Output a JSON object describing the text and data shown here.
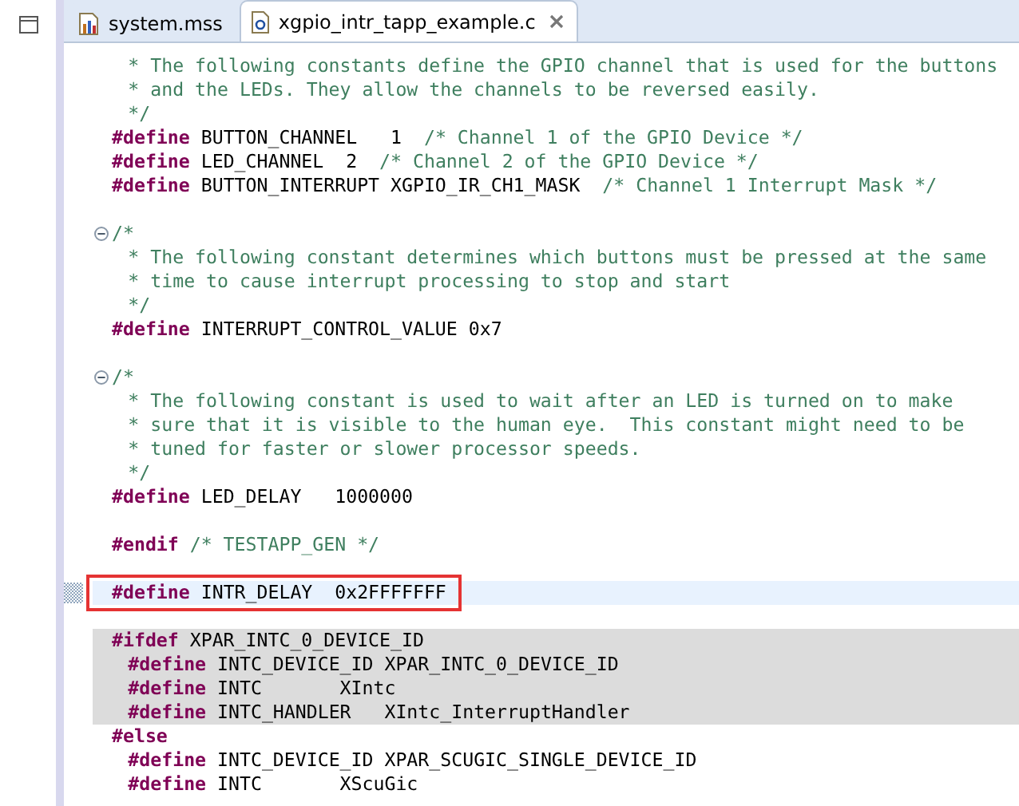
{
  "tabs": [
    {
      "label": "system.mss",
      "kind": "config",
      "selected": false,
      "closable": false
    },
    {
      "label": "xgpio_intr_tapp_example.c",
      "kind": "c",
      "selected": true,
      "closable": true
    }
  ],
  "lines": [
    {
      "kind": "code",
      "indented": true,
      "foldable": false,
      "inactive": false,
      "current": false,
      "boxed": false,
      "comment": "* The following constants define the GPIO channel that is used for the buttons"
    },
    {
      "kind": "code",
      "indented": true,
      "foldable": false,
      "inactive": false,
      "current": false,
      "boxed": false,
      "comment": "* and the LEDs. They allow the channels to be reversed easily."
    },
    {
      "kind": "code",
      "indented": true,
      "foldable": false,
      "inactive": false,
      "current": false,
      "boxed": false,
      "comment": "*/"
    },
    {
      "kind": "code",
      "indented": false,
      "foldable": false,
      "inactive": false,
      "current": false,
      "boxed": false,
      "directive": "#define",
      "code": "BUTTON_CHANNEL   1",
      "comment": "/* Channel 1 of the GPIO Device */"
    },
    {
      "kind": "code",
      "indented": false,
      "foldable": false,
      "inactive": false,
      "current": false,
      "boxed": false,
      "directive": "#define",
      "code": "LED_CHANNEL  2",
      "comment": "/* Channel 2 of the GPIO Device */"
    },
    {
      "kind": "code",
      "indented": false,
      "foldable": false,
      "inactive": false,
      "current": false,
      "boxed": false,
      "directive": "#define",
      "code": "BUTTON_INTERRUPT XGPIO_IR_CH1_MASK",
      "comment": "/* Channel 1 Interrupt Mask */"
    },
    {
      "kind": "blank"
    },
    {
      "kind": "code",
      "indented": false,
      "foldable": true,
      "inactive": false,
      "current": false,
      "boxed": false,
      "comment": "/*"
    },
    {
      "kind": "code",
      "indented": true,
      "foldable": false,
      "inactive": false,
      "current": false,
      "boxed": false,
      "comment": "* The following constant determines which buttons must be pressed at the same"
    },
    {
      "kind": "code",
      "indented": true,
      "foldable": false,
      "inactive": false,
      "current": false,
      "boxed": false,
      "comment": "* time to cause interrupt processing to stop and start"
    },
    {
      "kind": "code",
      "indented": true,
      "foldable": false,
      "inactive": false,
      "current": false,
      "boxed": false,
      "comment": "*/"
    },
    {
      "kind": "code",
      "indented": false,
      "foldable": false,
      "inactive": false,
      "current": false,
      "boxed": false,
      "directive": "#define",
      "code": "INTERRUPT_CONTROL_VALUE 0x7"
    },
    {
      "kind": "blank"
    },
    {
      "kind": "code",
      "indented": false,
      "foldable": true,
      "inactive": false,
      "current": false,
      "boxed": false,
      "comment": "/*"
    },
    {
      "kind": "code",
      "indented": true,
      "foldable": false,
      "inactive": false,
      "current": false,
      "boxed": false,
      "comment": "* The following constant is used to wait after an LED is turned on to make"
    },
    {
      "kind": "code",
      "indented": true,
      "foldable": false,
      "inactive": false,
      "current": false,
      "boxed": false,
      "comment": "* sure that it is visible to the human eye.  This constant might need to be"
    },
    {
      "kind": "code",
      "indented": true,
      "foldable": false,
      "inactive": false,
      "current": false,
      "boxed": false,
      "comment": "* tuned for faster or slower processor speeds."
    },
    {
      "kind": "code",
      "indented": true,
      "foldable": false,
      "inactive": false,
      "current": false,
      "boxed": false,
      "comment": "*/"
    },
    {
      "kind": "code",
      "indented": false,
      "foldable": false,
      "inactive": false,
      "current": false,
      "boxed": false,
      "directive": "#define",
      "code": "LED_DELAY   1000000"
    },
    {
      "kind": "blank"
    },
    {
      "kind": "code",
      "indented": false,
      "foldable": false,
      "inactive": false,
      "current": false,
      "boxed": false,
      "directive": "#endif",
      "comment": "/* TESTAPP_GEN */"
    },
    {
      "kind": "blank"
    },
    {
      "kind": "code",
      "indented": false,
      "foldable": false,
      "inactive": false,
      "current": true,
      "boxed": true,
      "directive": "#define",
      "code": "INTR_DELAY  0x2FFFFFFF"
    },
    {
      "kind": "blank"
    },
    {
      "kind": "code",
      "indented": false,
      "foldable": false,
      "inactive": true,
      "current": false,
      "boxed": false,
      "directive": "#ifdef",
      "code": "XPAR_INTC_0_DEVICE_ID"
    },
    {
      "kind": "code",
      "indented": true,
      "foldable": false,
      "inactive": true,
      "current": false,
      "boxed": false,
      "directive": "#define",
      "code": "INTC_DEVICE_ID XPAR_INTC_0_DEVICE_ID"
    },
    {
      "kind": "code",
      "indented": true,
      "foldable": false,
      "inactive": true,
      "current": false,
      "boxed": false,
      "directive": "#define",
      "code": "INTC       XIntc"
    },
    {
      "kind": "code",
      "indented": true,
      "foldable": false,
      "inactive": true,
      "current": false,
      "boxed": false,
      "directive": "#define",
      "code": "INTC_HANDLER   XIntc_InterruptHandler"
    },
    {
      "kind": "code",
      "indented": false,
      "foldable": false,
      "inactive": false,
      "current": false,
      "boxed": false,
      "directive": "#else"
    },
    {
      "kind": "code",
      "indented": true,
      "foldable": false,
      "inactive": false,
      "current": false,
      "boxed": false,
      "directive": "#define",
      "code": "INTC_DEVICE_ID XPAR_SCUGIC_SINGLE_DEVICE_ID"
    },
    {
      "kind": "code",
      "indented": true,
      "foldable": false,
      "inactive": false,
      "current": false,
      "boxed": false,
      "directive": "#define",
      "code": "INTC       XScuGic"
    }
  ]
}
